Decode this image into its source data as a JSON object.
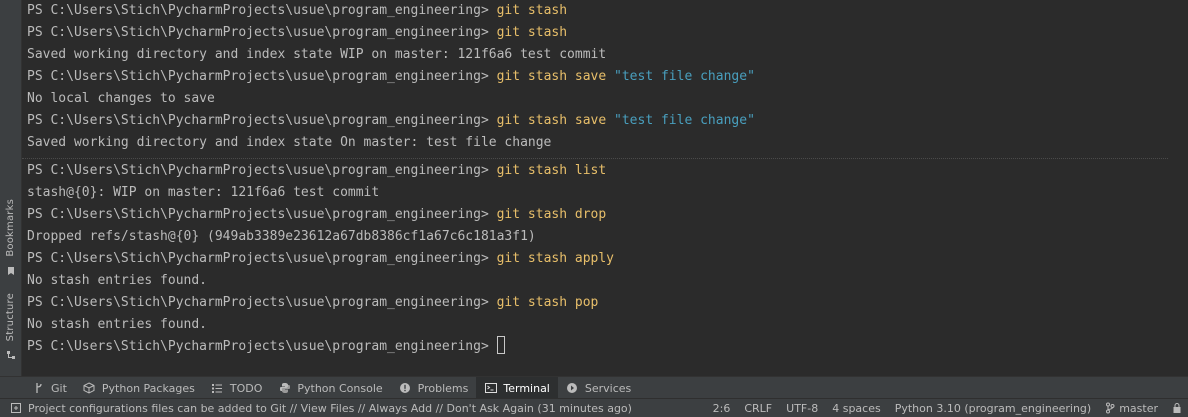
{
  "side_tabs": {
    "bookmarks": "Bookmarks",
    "structure": "Structure"
  },
  "terminal": {
    "lines": [
      {
        "prompt": "PS C:\\Users\\Stich\\PycharmProjects\\usue\\program_engineering>",
        "cmd": "git stash",
        "arg": ""
      },
      {
        "prompt": "PS C:\\Users\\Stich\\PycharmProjects\\usue\\program_engineering>",
        "cmd": "git stash",
        "arg": ""
      },
      {
        "text": "Saved working directory and index state WIP on master: 121f6a6 test commit"
      },
      {
        "prompt": "PS C:\\Users\\Stich\\PycharmProjects\\usue\\program_engineering>",
        "cmd": "git stash save",
        "arg": "\"test file change\""
      },
      {
        "text": "No local changes to save"
      },
      {
        "prompt": "PS C:\\Users\\Stich\\PycharmProjects\\usue\\program_engineering>",
        "cmd": "git stash save",
        "arg": "\"test file change\""
      },
      {
        "text": "Saved working directory and index state On master: test file change"
      },
      {
        "prompt": "PS C:\\Users\\Stich\\PycharmProjects\\usue\\program_engineering>",
        "cmd": "git stash list",
        "arg": ""
      },
      {
        "text": "stash@{0}: WIP on master: 121f6a6 test commit"
      },
      {
        "prompt": "PS C:\\Users\\Stich\\PycharmProjects\\usue\\program_engineering>",
        "cmd": "git stash drop",
        "arg": ""
      },
      {
        "text": "Dropped refs/stash@{0} (949ab3389e23612a67db8386cf1a67c6c181a3f1)"
      },
      {
        "prompt": "PS C:\\Users\\Stich\\PycharmProjects\\usue\\program_engineering>",
        "cmd": "git stash apply",
        "arg": ""
      },
      {
        "text": "No stash entries found."
      },
      {
        "prompt": "PS C:\\Users\\Stich\\PycharmProjects\\usue\\program_engineering>",
        "cmd": "git stash pop",
        "arg": ""
      },
      {
        "text": "No stash entries found."
      },
      {
        "prompt": "PS C:\\Users\\Stich\\PycharmProjects\\usue\\program_engineering>",
        "cmd": "",
        "arg": "",
        "cursor": true
      }
    ]
  },
  "toolbar": {
    "tabs": [
      {
        "label": "Git",
        "icon": "git-branch-icon",
        "active": false
      },
      {
        "label": "Python Packages",
        "icon": "packages-icon",
        "active": false
      },
      {
        "label": "TODO",
        "icon": "todo-list-icon",
        "active": false
      },
      {
        "label": "Python Console",
        "icon": "python-icon",
        "active": false
      },
      {
        "label": "Problems",
        "icon": "problems-icon",
        "active": false
      },
      {
        "label": "Terminal",
        "icon": "terminal-icon",
        "active": true
      },
      {
        "label": "Services",
        "icon": "services-icon",
        "active": false
      }
    ]
  },
  "statusbar": {
    "message": "Project configurations files can be added to Git // View Files // Always Add // Don't Ask Again (31 minutes ago)",
    "position": "2:6",
    "line_ending": "CRLF",
    "encoding": "UTF-8",
    "indent": "4 spaces",
    "interpreter": "Python 3.10 (program_engineering)",
    "branch": "master"
  },
  "colors": {
    "background": "#2b2b2b",
    "command": "#e8bf6a",
    "string": "#499fbe",
    "text": "#bbbbbb"
  }
}
